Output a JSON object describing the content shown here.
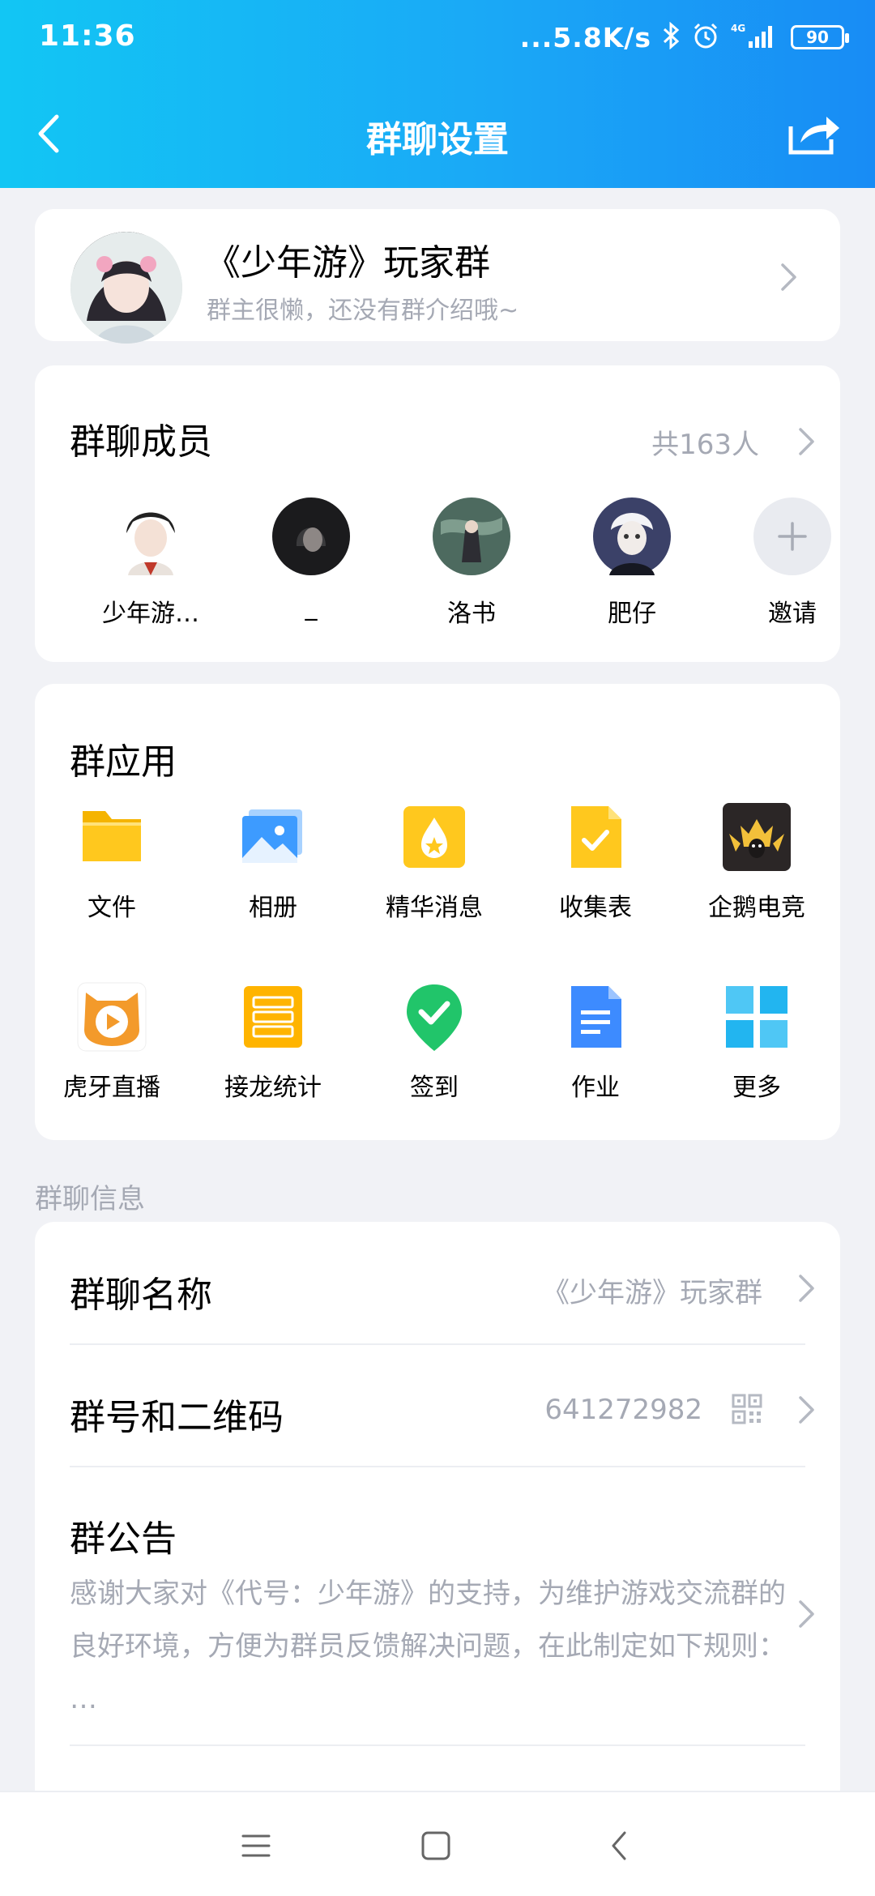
{
  "status": {
    "time": "11:36",
    "network_speed": "...5.8K/s",
    "signal_label": "4G",
    "battery": "90"
  },
  "header": {
    "title": "群聊设置",
    "back_icon": "chevron-left-icon",
    "share_icon": "share-icon"
  },
  "group": {
    "name": "《少年游》玩家群",
    "description": "群主很懒，还没有群介绍哦~"
  },
  "members": {
    "title": "群聊成员",
    "count": "共163人",
    "items": [
      {
        "name": "少年游…",
        "color": "#e8e2dc"
      },
      {
        "name": "_",
        "color": "#1b1b1d"
      },
      {
        "name": "洛书",
        "color": "#4d6a5f"
      },
      {
        "name": "肥仔",
        "color": "#3b4168"
      },
      {
        "name": "邀请",
        "color": "#e9ebf0"
      }
    ]
  },
  "apps": {
    "title": "群应用",
    "items": [
      {
        "label": "文件",
        "icon": "folder-icon"
      },
      {
        "label": "相册",
        "icon": "album-icon"
      },
      {
        "label": "精华消息",
        "icon": "essence-icon"
      },
      {
        "label": "收集表",
        "icon": "form-icon"
      },
      {
        "label": "企鹅电竞",
        "icon": "esports-icon"
      },
      {
        "label": "虎牙直播",
        "icon": "huya-icon"
      },
      {
        "label": "接龙统计",
        "icon": "relay-icon"
      },
      {
        "label": "签到",
        "icon": "checkin-icon"
      },
      {
        "label": "作业",
        "icon": "homework-icon"
      },
      {
        "label": "更多",
        "icon": "more-icon"
      }
    ]
  },
  "info": {
    "section_label": "群聊信息",
    "name_row": {
      "title": "群聊名称",
      "value": "《少年游》玩家群"
    },
    "number_row": {
      "title": "群号和二维码",
      "value": "641272982"
    },
    "notice_row": {
      "title": "群公告",
      "text": "感谢大家对《代号：少年游》的支持，为维护游戏交流群的良好环境，方便为群员反馈解决问题，在此制定如下规则：  …"
    }
  },
  "colors": {
    "accent": "#1aa9f6",
    "muted_text": "#a5a9b4",
    "page_bg": "#f1f2f6"
  }
}
